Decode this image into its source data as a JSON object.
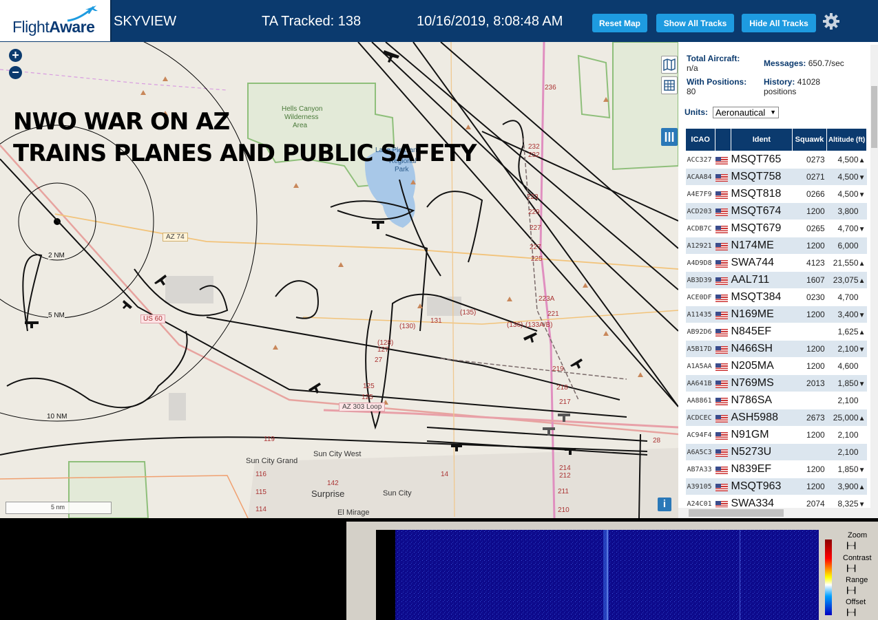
{
  "header": {
    "logo_text_light": "Flight",
    "logo_text_bold": "Aware",
    "app_name": "SKYVIEW",
    "tracked": "TA Tracked: 138",
    "datetime": "10/16/2019, 8:08:48 AM",
    "buttons": [
      "Reset Map",
      "Show All Tracks",
      "Hide All Tracks"
    ],
    "settings_icon": "gear-icon"
  },
  "map": {
    "overlay_line1": "NWO WAR ON AZ",
    "overlay_line2": "TRAINS PLANES AND PUBLIC SAFETY",
    "zoom_in": "+",
    "zoom_out": "−",
    "scale_label": "5 nm",
    "range_rings": [
      "2 NM",
      "5 NM",
      "10 NM"
    ],
    "place_labels": [
      "Hells Canyon",
      "Wilderness",
      "Area",
      "Lake Pleasant",
      "Regional",
      "Park",
      "Sun City Grand",
      "Sun City West",
      "Sun City",
      "Surprise",
      "El Mirage"
    ],
    "road_labels": [
      "AZ 74",
      "AZ 303 Loop",
      "236",
      "232",
      "232",
      "229",
      "227",
      "227",
      "225",
      "223",
      "223A",
      "221",
      "219",
      "218",
      "217",
      "214",
      "212",
      "211",
      "210",
      "(130)",
      "131",
      "(135)",
      "(128)",
      "127",
      "27",
      "125",
      "125",
      "(136)",
      "(133A/B)",
      "119",
      "116",
      "115",
      "114",
      "142",
      "14",
      "28",
      "US 60"
    ],
    "icons": [
      "map-layer-icon",
      "grid-icon",
      "columns-icon",
      "info-icon"
    ]
  },
  "panel": {
    "total_aircraft_label": "Total Aircraft:",
    "total_aircraft_value": "n/a",
    "messages_label": "Messages:",
    "messages_value": "650.7/sec",
    "positions_label": "With Positions:",
    "positions_value": "80",
    "history_label": "History:",
    "history_value": "41028",
    "history_unit": "positions",
    "units_label": "Units:",
    "units_value": "Aeronautical",
    "columns": [
      "ICAO",
      "",
      "Ident",
      "Squawk",
      "Altitude (ft)"
    ],
    "rows": [
      {
        "icao": "ACC327",
        "ident": "MSQT765",
        "squawk": "0273",
        "alt": "4,500",
        "trend": "▲"
      },
      {
        "icao": "ACAA84",
        "ident": "MSQT758",
        "squawk": "0271",
        "alt": "4,500",
        "trend": "▼"
      },
      {
        "icao": "A4E7F9",
        "ident": "MSQT818",
        "squawk": "0266",
        "alt": "4,500",
        "trend": "▼"
      },
      {
        "icao": "ACD203",
        "ident": "MSQT674",
        "squawk": "1200",
        "alt": "3,800",
        "trend": ""
      },
      {
        "icao": "ACDB7C",
        "ident": "MSQT679",
        "squawk": "0265",
        "alt": "4,700",
        "trend": "▼"
      },
      {
        "icao": "A12921",
        "ident": "N174ME",
        "squawk": "1200",
        "alt": "6,000",
        "trend": ""
      },
      {
        "icao": "A4D9D8",
        "ident": "SWA744",
        "squawk": "4123",
        "alt": "21,550",
        "trend": "▲"
      },
      {
        "icao": "AB3D39",
        "ident": "AAL711",
        "squawk": "1607",
        "alt": "23,075",
        "trend": "▲"
      },
      {
        "icao": "ACE0DF",
        "ident": "MSQT384",
        "squawk": "0230",
        "alt": "4,700",
        "trend": ""
      },
      {
        "icao": "A11435",
        "ident": "N169ME",
        "squawk": "1200",
        "alt": "3,400",
        "trend": "▼"
      },
      {
        "icao": "AB92D6",
        "ident": "N845EF",
        "squawk": "",
        "alt": "1,625",
        "trend": "▲"
      },
      {
        "icao": "A5B17D",
        "ident": "N466SH",
        "squawk": "1200",
        "alt": "2,100",
        "trend": "▼"
      },
      {
        "icao": "A1A5AA",
        "ident": "N205MA",
        "squawk": "1200",
        "alt": "4,600",
        "trend": ""
      },
      {
        "icao": "AA641B",
        "ident": "N769MS",
        "squawk": "2013",
        "alt": "1,850",
        "trend": "▼"
      },
      {
        "icao": "AA8861",
        "ident": "N786SA",
        "squawk": "",
        "alt": "2,100",
        "trend": ""
      },
      {
        "icao": "ACDCEC",
        "ident": "ASH5988",
        "squawk": "2673",
        "alt": "25,000",
        "trend": "▲"
      },
      {
        "icao": "AC94F4",
        "ident": "N91GM",
        "squawk": "1200",
        "alt": "2,100",
        "trend": ""
      },
      {
        "icao": "A6A5C3",
        "ident": "N5273U",
        "squawk": "",
        "alt": "2,100",
        "trend": ""
      },
      {
        "icao": "AB7A33",
        "ident": "N839EF",
        "squawk": "1200",
        "alt": "1,850",
        "trend": "▼"
      },
      {
        "icao": "A39105",
        "ident": "MSQT963",
        "squawk": "1200",
        "alt": "3,900",
        "trend": "▲"
      },
      {
        "icao": "A24C01",
        "ident": "SWA334",
        "squawk": "2074",
        "alt": "8,325",
        "trend": "▼"
      }
    ]
  },
  "spectrogram": {
    "controls": [
      "Zoom",
      "Contrast",
      "Range",
      "Offset"
    ]
  }
}
